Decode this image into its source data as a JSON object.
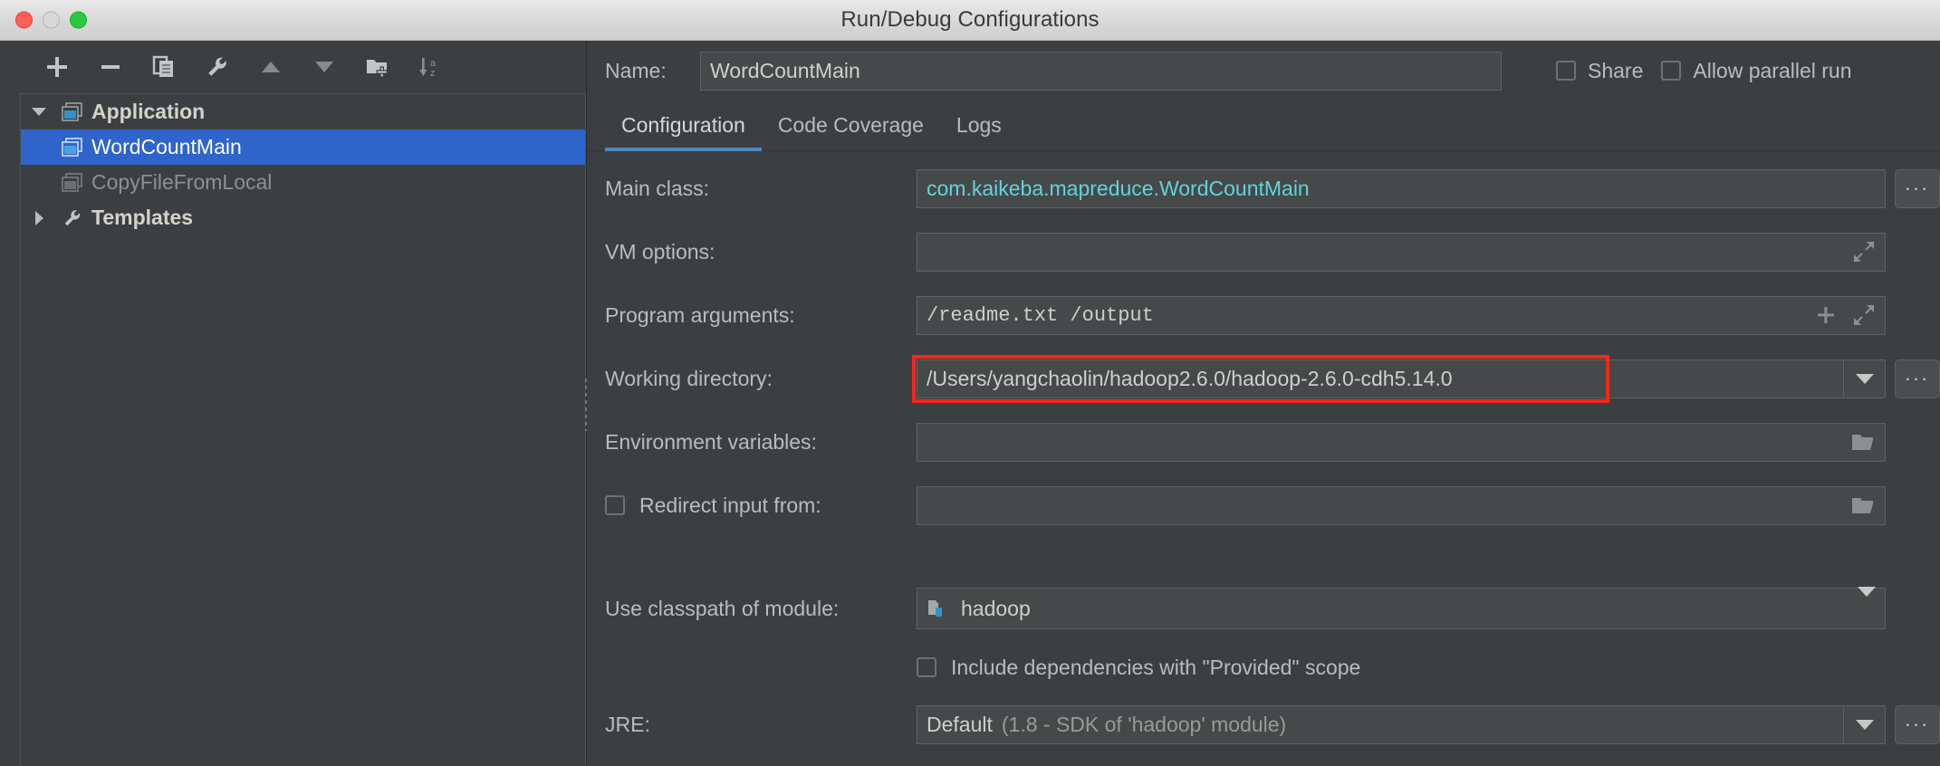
{
  "window": {
    "title": "Run/Debug Configurations",
    "traffic_lights": [
      "close",
      "minimize",
      "maximize"
    ]
  },
  "left_panel": {
    "toolbar": [
      {
        "name": "add-button",
        "icon": "plus-icon"
      },
      {
        "name": "remove-button",
        "icon": "minus-icon"
      },
      {
        "name": "copy-configuration-button",
        "icon": "copy-icon"
      },
      {
        "name": "edit-templates-button",
        "icon": "wrench-icon"
      },
      {
        "name": "move-up-button",
        "icon": "arrow-up-icon"
      },
      {
        "name": "move-down-button",
        "icon": "arrow-down-icon"
      },
      {
        "name": "new-folder-button",
        "icon": "folder-add-icon"
      },
      {
        "name": "sort-configurations-button",
        "icon": "sort-az-icon"
      }
    ],
    "tree": [
      {
        "label": "Application",
        "level": 0,
        "expanded": true,
        "state": "group",
        "icon": "application-icon"
      },
      {
        "label": "WordCountMain",
        "level": 1,
        "expanded": null,
        "state": "selected",
        "icon": "application-icon"
      },
      {
        "label": "CopyFileFromLocal",
        "level": 1,
        "expanded": null,
        "state": "dim",
        "icon": "application-icon"
      },
      {
        "label": "Templates",
        "level": 0,
        "expanded": false,
        "state": "group",
        "icon": "wrench-icon"
      }
    ]
  },
  "header": {
    "name_label": "Name:",
    "name_value": "WordCountMain",
    "share": {
      "label": "Share",
      "checked": false
    },
    "allow_parallel_run": {
      "label": "Allow parallel run",
      "checked": false
    }
  },
  "tabs": [
    {
      "label": "Configuration",
      "active": true
    },
    {
      "label": "Code Coverage",
      "active": false
    },
    {
      "label": "Logs",
      "active": false
    }
  ],
  "form": {
    "main_class": {
      "label": "Main class:",
      "value": "com.kaikeba.mapreduce.WordCountMain",
      "browse_label": "..."
    },
    "vm_options": {
      "label": "VM options:",
      "value": "",
      "placeholder": ""
    },
    "program_arguments": {
      "label": "Program arguments:",
      "value": "/readme.txt /output"
    },
    "working_directory": {
      "label": "Working directory:",
      "value": "/Users/yangchaolin/hadoop2.6.0/hadoop-2.6.0-cdh5.14.0",
      "browse_label": "...",
      "highlighted": true,
      "highlight_color": "#f4271c"
    },
    "environment_variables": {
      "label": "Environment variables:",
      "value": ""
    },
    "redirect_input_from": {
      "label": "Redirect input from:",
      "value": "",
      "checked": false
    },
    "use_classpath_of_module": {
      "label": "Use classpath of module:",
      "value": "hadoop"
    },
    "include_provided_scope": {
      "label": "Include dependencies with \"Provided\" scope",
      "checked": false
    },
    "jre": {
      "label": "JRE:",
      "value_main": "Default",
      "value_detail": "(1.8 - SDK of 'hadoop' module)",
      "browse_label": "..."
    }
  },
  "colors": {
    "background": "#3c3f41",
    "field_background": "#45494a",
    "selection_blue": "#2f65ca",
    "tab_accent": "#4a88c7",
    "link_cyan": "#63d3db",
    "annotation_red": "#f4271c"
  }
}
